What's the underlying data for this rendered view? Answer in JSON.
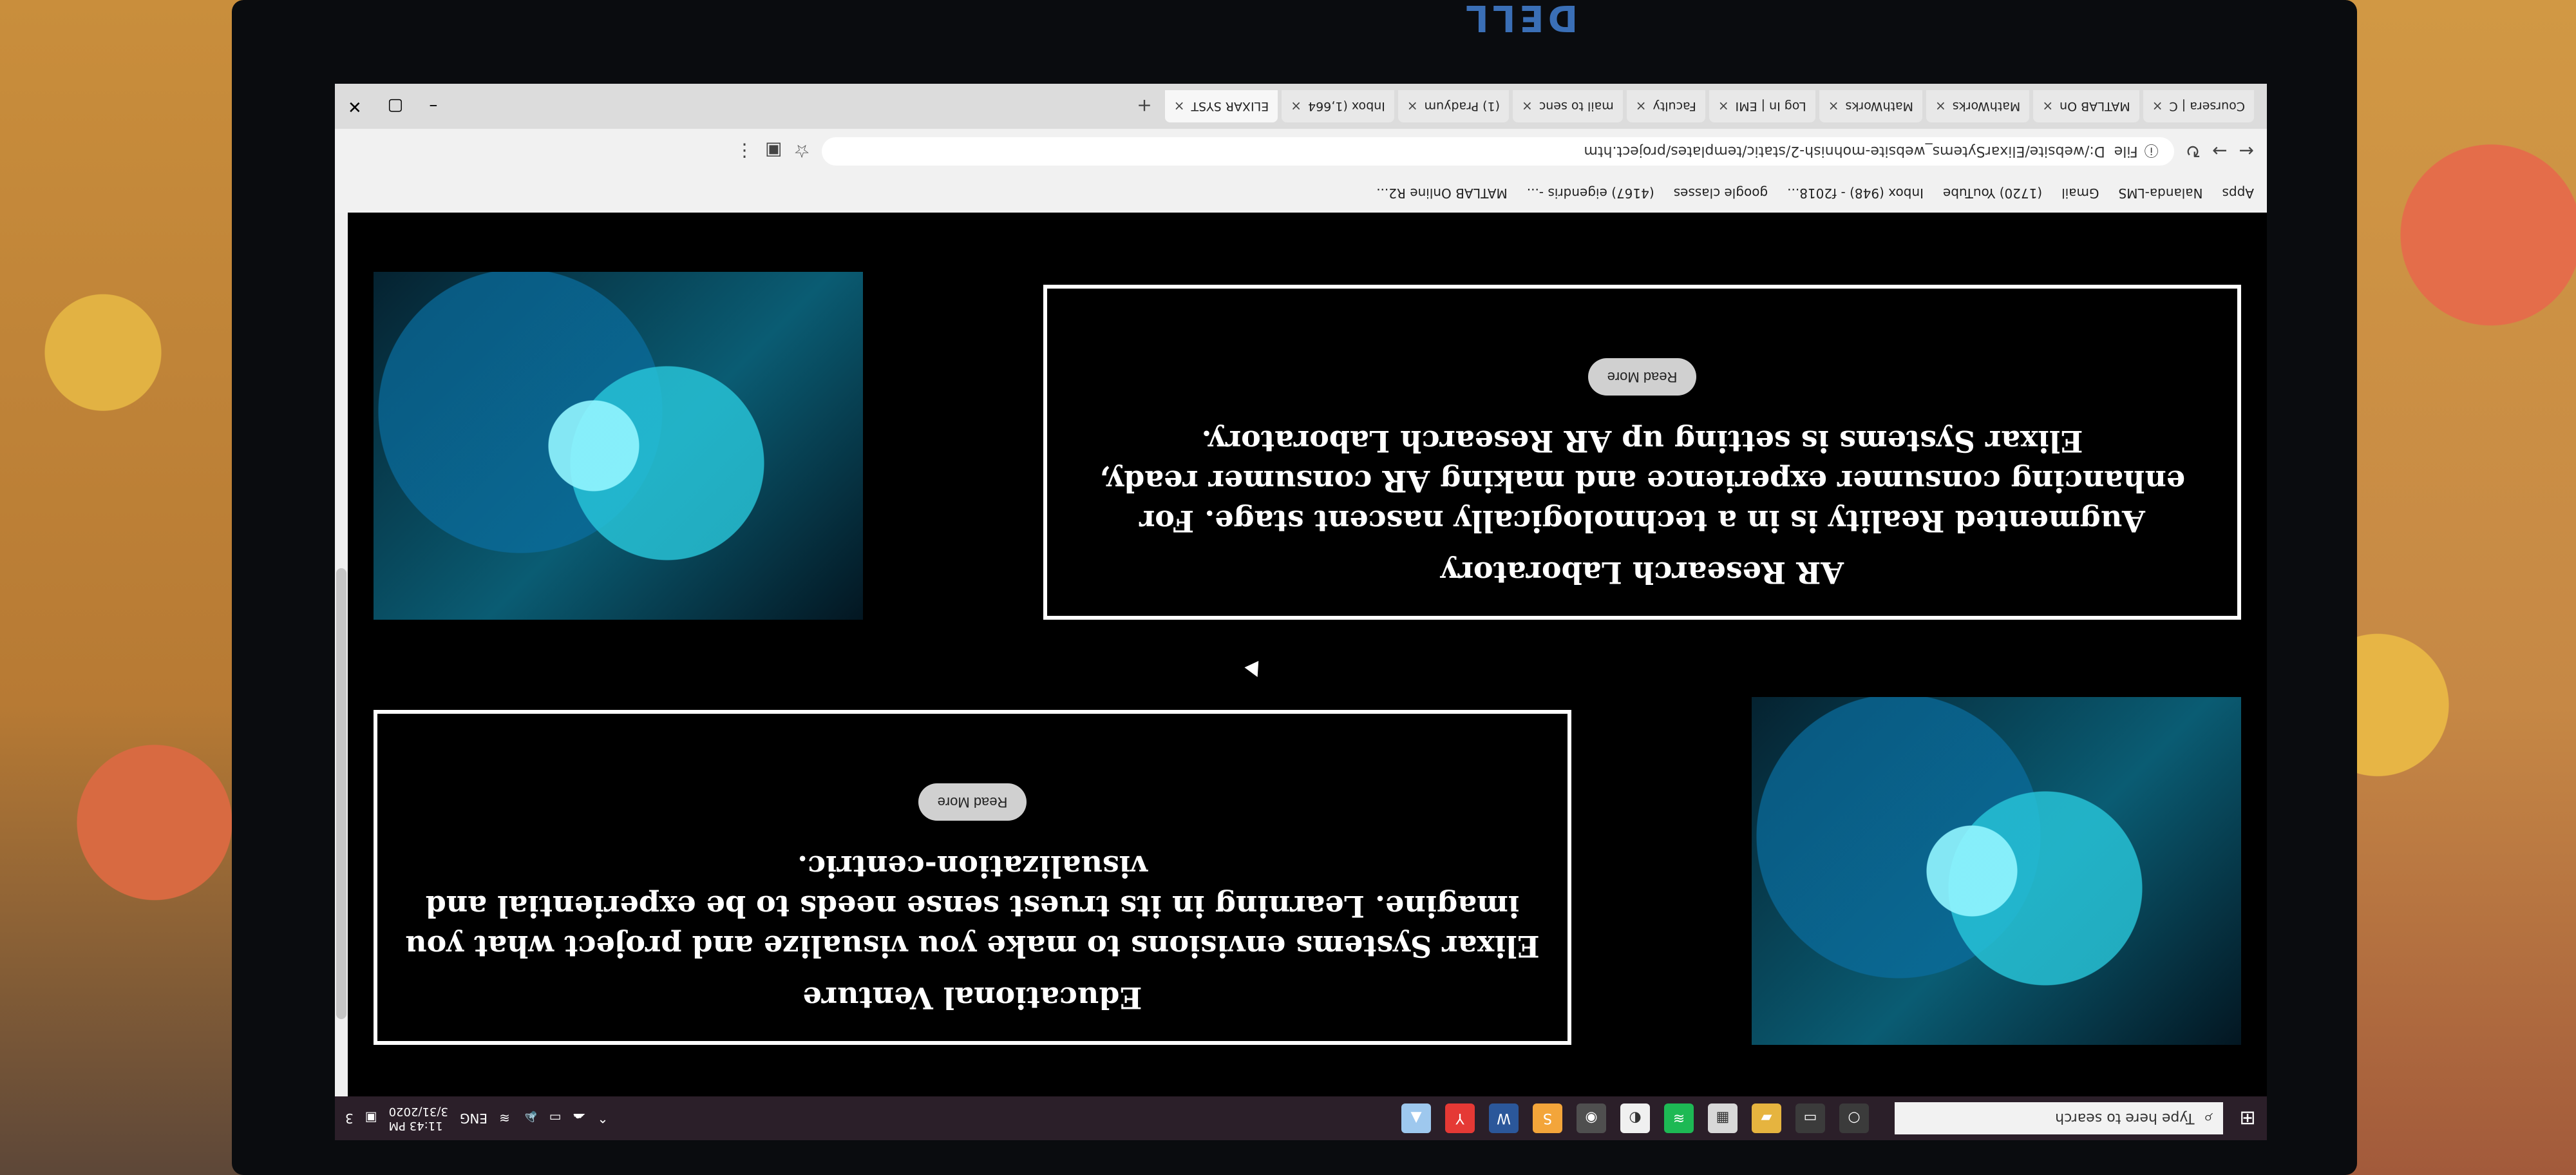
{
  "brand": {
    "logo_text": "DELL"
  },
  "taskbar": {
    "search_placeholder": "Type here to search",
    "icons": [
      "windows-start",
      "cortana",
      "task-view",
      "file-explorer",
      "store",
      "spotify",
      "alt-app",
      "chrome",
      "sublime",
      "word",
      "yandex",
      "photos"
    ],
    "tray_lang": "ENG",
    "time": "11:43 PM",
    "date": "3/31/2020",
    "notification_count": "3"
  },
  "browser": {
    "tabs": [
      {
        "label": "Coursera | C"
      },
      {
        "label": "MATLAB On"
      },
      {
        "label": "MathWorks"
      },
      {
        "label": "MathWorks"
      },
      {
        "label": "Log In | EMI"
      },
      {
        "label": "Faculty"
      },
      {
        "label": "mail to senc"
      },
      {
        "label": "(1) Pradyum"
      },
      {
        "label": "Inbox (1,664"
      },
      {
        "label": "ELIXAR SYST"
      }
    ],
    "new_tab_symbol": "+",
    "url_prefix": "File",
    "url": "D:/website/ElixarSytems_website-mohnish-2/static/templates/project.htm",
    "bookmarks": [
      "Apps",
      "Nalanda-LMS",
      "Gmail",
      "(1720) YouTube",
      "Inbox (948) - f2018...",
      "google classes",
      "(4167) eigendris -...",
      "MATLAB Online R2..."
    ]
  },
  "content": {
    "sections": [
      {
        "title": "AR Research Laboratory",
        "body": "Augmented Reality is in a technologically nascent stage. For enhancing consumer experience and making AR consumer ready, Elixar Systems is setting up AR Research Laboratory.",
        "button": "Read More"
      },
      {
        "title": "Educational Venture",
        "body": "Elixar Systems envisions to make you visualize and project what you imagine. Learning in its truest sense needs to be experiential and visualization-centric.",
        "button": "Read More"
      }
    ]
  }
}
